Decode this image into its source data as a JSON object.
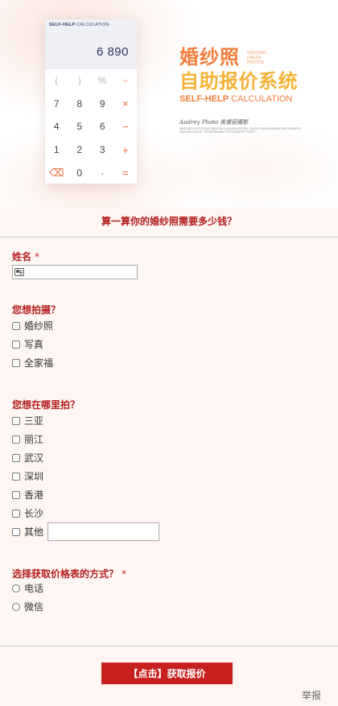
{
  "banner": {
    "calc_brand_bold": "SELF-HELP",
    "calc_brand_rest": " CALCULATION",
    "calc_display": "6 890",
    "calc_keys": [
      "(",
      ")",
      "%",
      "÷",
      "7",
      "8",
      "9",
      "×",
      "4",
      "5",
      "6",
      "−",
      "1",
      "2",
      "3",
      "+",
      "⌫",
      "0",
      "·",
      "="
    ],
    "title_line1": "婚纱照",
    "title_line2": "自助报价系统",
    "small_en": [
      "WEDDING",
      "DRESS",
      "PHOTOS"
    ],
    "en_bold": "SELF-HELP",
    "en_rest": " CALCULATION",
    "signature": "Audrey Photo 奥黛丽摄影",
    "fine_print": "WEDDING PHOTOS SELF-HELP CALCULATION SYSTEM · QUOTE YOUR WEDDING PHOTOGRAPHY PACKAGE ONLINE · PROFESSIONAL PHOTOGRAPHY STUDIO"
  },
  "form": {
    "title": "算一算你的婚纱照需要多少钱？",
    "name_label": "姓名",
    "required_mark": "*",
    "q1_label": "您想拍摄？",
    "q1_options": [
      "婚纱照",
      "写真",
      "全家福"
    ],
    "q2_label": "您想在哪里拍？",
    "q2_options": [
      "三亚",
      "丽江",
      "武汉",
      "深圳",
      "香港",
      "长沙",
      "其他"
    ],
    "q3_label": "选择获取价格表的方式？",
    "q3_options": [
      "电话",
      "微信"
    ],
    "submit_label": "【点击】获取报价",
    "report_label": "举报"
  },
  "colors": {
    "accent_red": "#c7201f",
    "label_red": "#b31e1e",
    "banner_orange": "#f37c3a",
    "banner_yellow": "#f5b338"
  }
}
